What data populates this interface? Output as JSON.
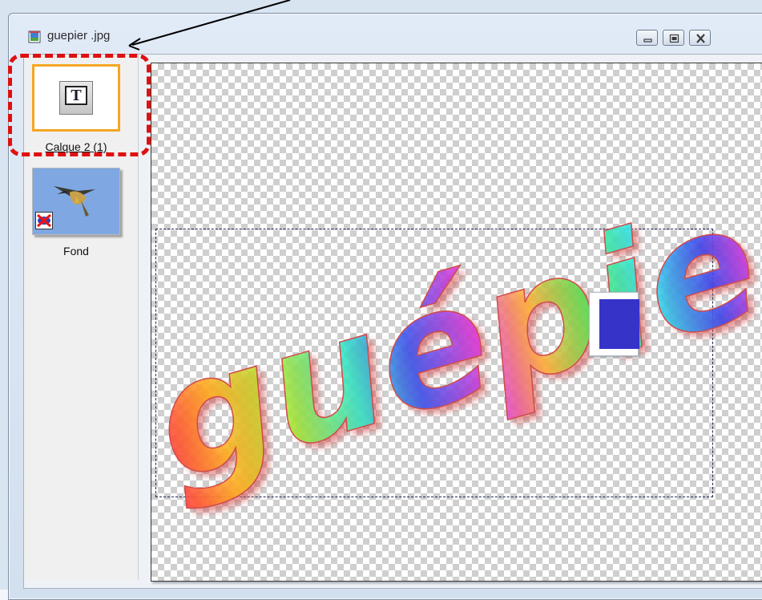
{
  "window": {
    "title": "guepier .jpg",
    "app_icon": "image-file-icon",
    "controls": [
      "minimize-icon",
      "restore-icon",
      "close-icon"
    ]
  },
  "layers": [
    {
      "label": "Calque 2 (1)",
      "type": "text-layer",
      "icon": "text-tool-icon",
      "selected": true,
      "visible": true
    },
    {
      "label": "Fond",
      "type": "image-layer",
      "icon": "bird-thumbnail",
      "selected": false,
      "visible": false,
      "badge": "hidden-eye-icon"
    }
  ],
  "canvas": {
    "text": "guépier",
    "background": "transparent-checkerboard",
    "selection": "dashed"
  },
  "color_swatch": {
    "color": "#3633c9"
  },
  "annotation": {
    "color": "#e01010",
    "target": "layer Calque 2 (1)"
  }
}
